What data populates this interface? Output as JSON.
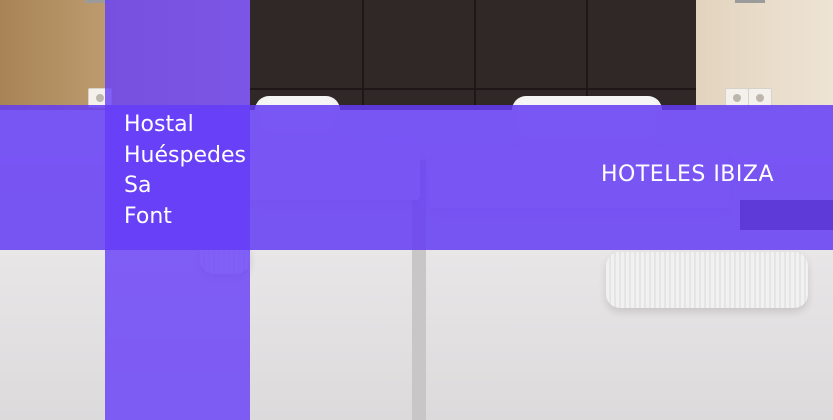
{
  "hotel": {
    "name_lines": [
      "Hostal",
      "Huéspedes",
      "Sa",
      "Font"
    ]
  },
  "category": {
    "label": "HOTELES IBIZA"
  },
  "colors": {
    "overlay": "#6440f5",
    "text": "#ffffff",
    "headboard": "#2f2827"
  }
}
